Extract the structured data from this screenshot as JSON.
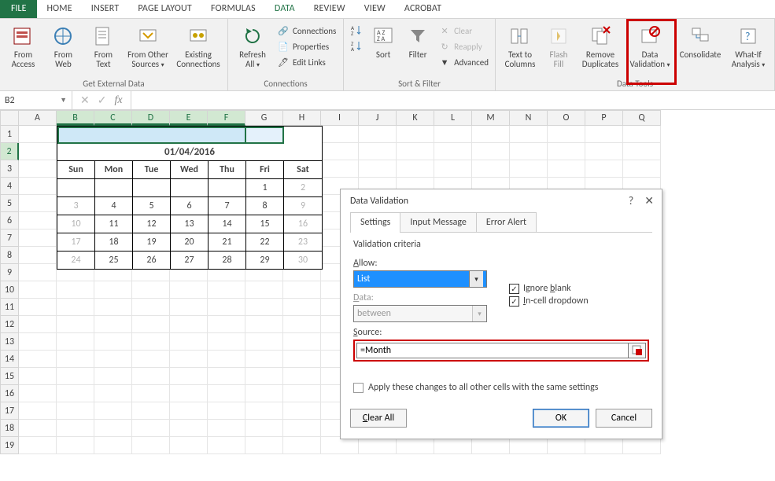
{
  "ribbon": {
    "file": "FILE",
    "tabs": [
      "HOME",
      "INSERT",
      "PAGE LAYOUT",
      "FORMULAS",
      "DATA",
      "REVIEW",
      "VIEW",
      "ACROBAT"
    ],
    "active_tab": "DATA",
    "groups": {
      "get_external": {
        "label": "Get External Data",
        "buttons": {
          "from_access": "From Access",
          "from_web": "From Web",
          "from_text": "From Text",
          "from_other": "From Other Sources",
          "existing_conn": "Existing Connections"
        }
      },
      "connections": {
        "label": "Connections",
        "refresh_all": "Refresh All",
        "connections": "Connections",
        "properties": "Properties",
        "edit_links": "Edit Links"
      },
      "sort_filter": {
        "label": "Sort & Filter",
        "sort": "Sort",
        "filter": "Filter",
        "clear": "Clear",
        "reapply": "Reapply",
        "advanced": "Advanced"
      },
      "data_tools": {
        "label": "Data Tools",
        "text_to_columns": "Text to Columns",
        "flash_fill": "Flash Fill",
        "remove_dup": "Remove Duplicates",
        "data_validation": "Data Validation",
        "consolidate": "Consolidate",
        "what_if": "What-If Analysis"
      }
    }
  },
  "namebox": {
    "value": "B2"
  },
  "formula": "",
  "columns": [
    "A",
    "B",
    "C",
    "D",
    "E",
    "F",
    "G",
    "H",
    "I",
    "J",
    "K",
    "L",
    "M",
    "N",
    "O",
    "P",
    "Q"
  ],
  "selected_cols": [
    "B",
    "C",
    "D",
    "E",
    "F"
  ],
  "rows_count": 19,
  "selected_row": 2,
  "calendar": {
    "title": "01/04/2016",
    "days": [
      "Sun",
      "Mon",
      "Tue",
      "Wed",
      "Thu",
      "Fri",
      "Sat"
    ],
    "weeks": [
      [
        {
          "v": ""
        },
        {
          "v": ""
        },
        {
          "v": ""
        },
        {
          "v": ""
        },
        {
          "v": ""
        },
        {
          "v": "1"
        },
        {
          "v": "2",
          "g": true
        }
      ],
      [
        {
          "v": "3",
          "g": true
        },
        {
          "v": "4"
        },
        {
          "v": "5"
        },
        {
          "v": "6"
        },
        {
          "v": "7"
        },
        {
          "v": "8"
        },
        {
          "v": "9",
          "g": true
        }
      ],
      [
        {
          "v": "10",
          "g": true
        },
        {
          "v": "11"
        },
        {
          "v": "12"
        },
        {
          "v": "13"
        },
        {
          "v": "14"
        },
        {
          "v": "15"
        },
        {
          "v": "16",
          "g": true
        }
      ],
      [
        {
          "v": "17",
          "g": true
        },
        {
          "v": "18"
        },
        {
          "v": "19"
        },
        {
          "v": "20"
        },
        {
          "v": "21"
        },
        {
          "v": "22"
        },
        {
          "v": "23",
          "g": true
        }
      ],
      [
        {
          "v": "24",
          "g": true
        },
        {
          "v": "25"
        },
        {
          "v": "26"
        },
        {
          "v": "27"
        },
        {
          "v": "28"
        },
        {
          "v": "29"
        },
        {
          "v": "30",
          "g": true
        }
      ]
    ]
  },
  "dialog": {
    "title": "Data Validation",
    "tabs": {
      "settings": "Settings",
      "input": "Input Message",
      "error": "Error Alert"
    },
    "criteria_label": "Validation criteria",
    "allow_label_pre": "",
    "allow_label": "Allow:",
    "allow_underline": "A",
    "allow_value": "List",
    "data_label": "Data:",
    "data_underline": "D",
    "data_value": "between",
    "source_label": "Source:",
    "source_underline": "S",
    "source_value": "=Month",
    "ignore_blank": "Ignore blank",
    "ignore_underline": "b",
    "incell": "In-cell dropdown",
    "incell_underline": "I",
    "apply_text": "Apply these changes to all other cells with the same settings",
    "apply_underline": "P",
    "clear_all": "Clear All",
    "clear_underline": "C",
    "ok": "OK",
    "cancel": "Cancel"
  }
}
